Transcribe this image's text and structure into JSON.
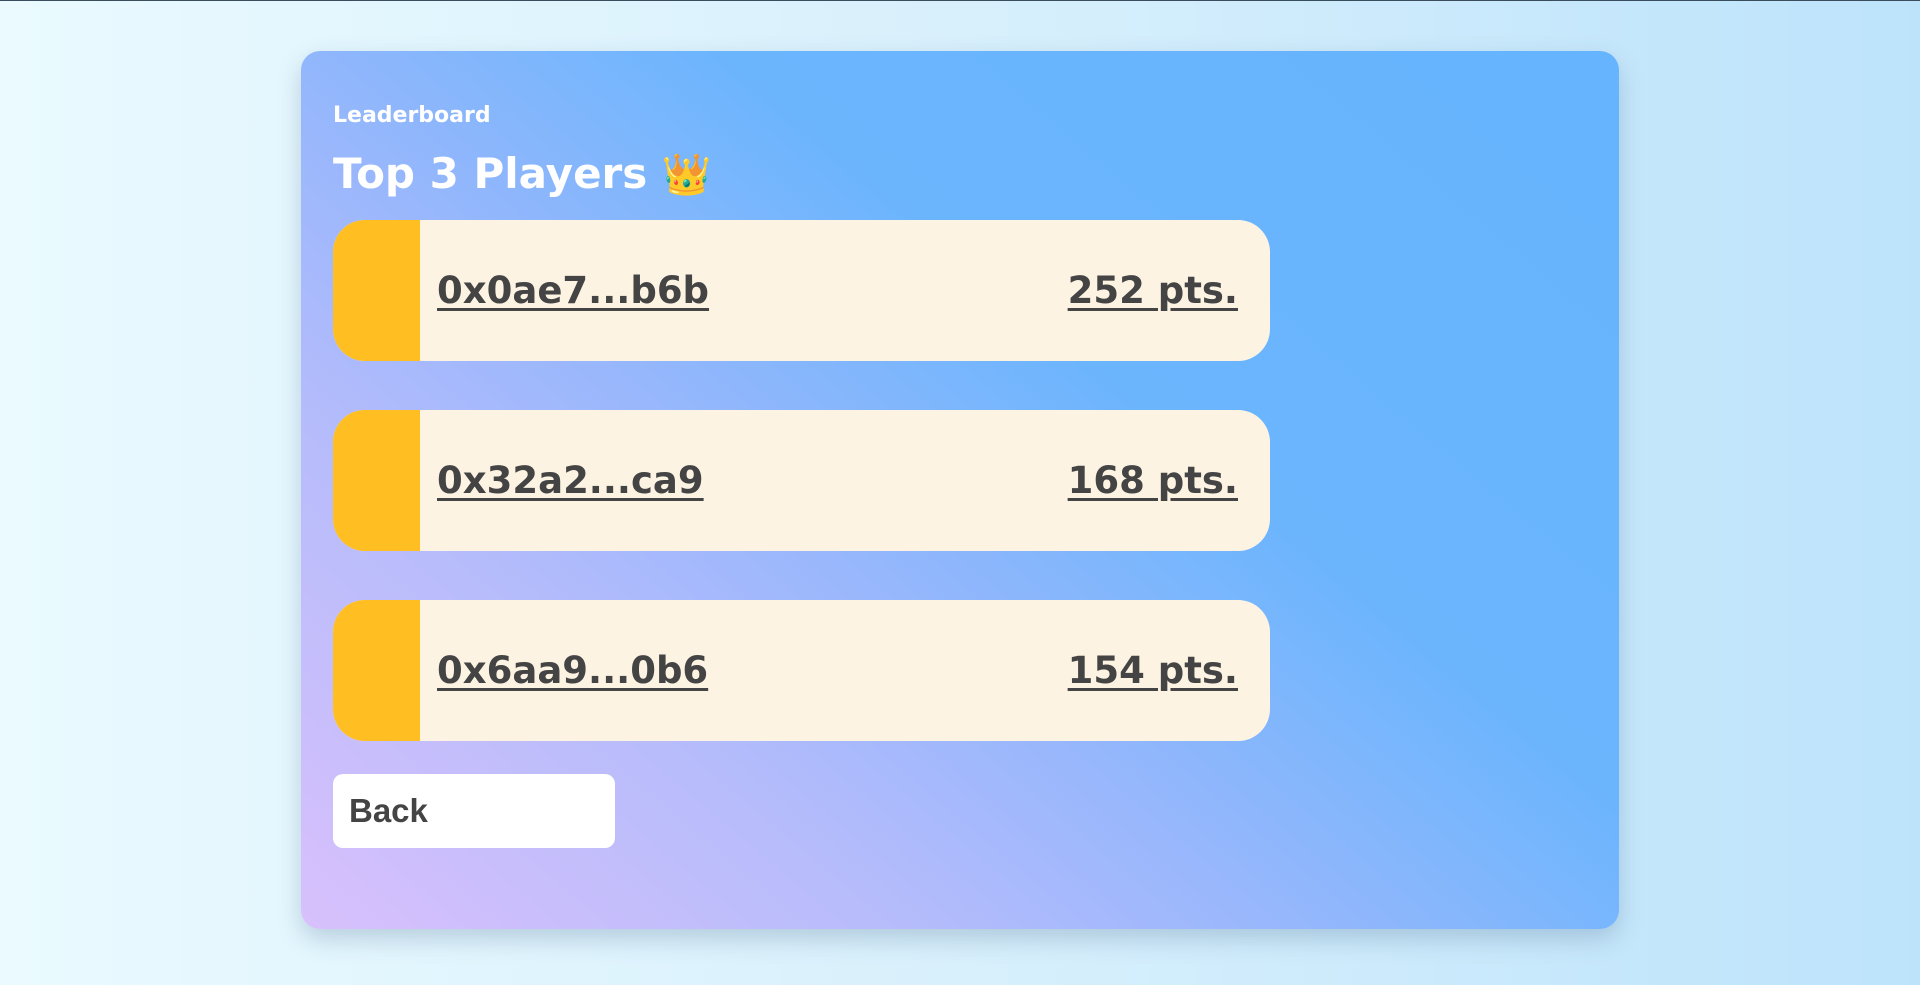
{
  "card": {
    "eyebrow": "Leaderboard",
    "title": "Top 3 Players",
    "title_emoji": "👑"
  },
  "players": [
    {
      "address": "0x0ae7...b6b",
      "points": "252 pts."
    },
    {
      "address": "0x32a2...ca9",
      "points": "168 pts."
    },
    {
      "address": "0x6aa9...0b6",
      "points": "154 pts."
    }
  ],
  "actions": {
    "back_label": "Back"
  },
  "colors": {
    "rank_stripe": "#ffbf23",
    "row_background": "#fdf3e3",
    "text_dark": "#444444",
    "heading_text": "#ffffff"
  }
}
